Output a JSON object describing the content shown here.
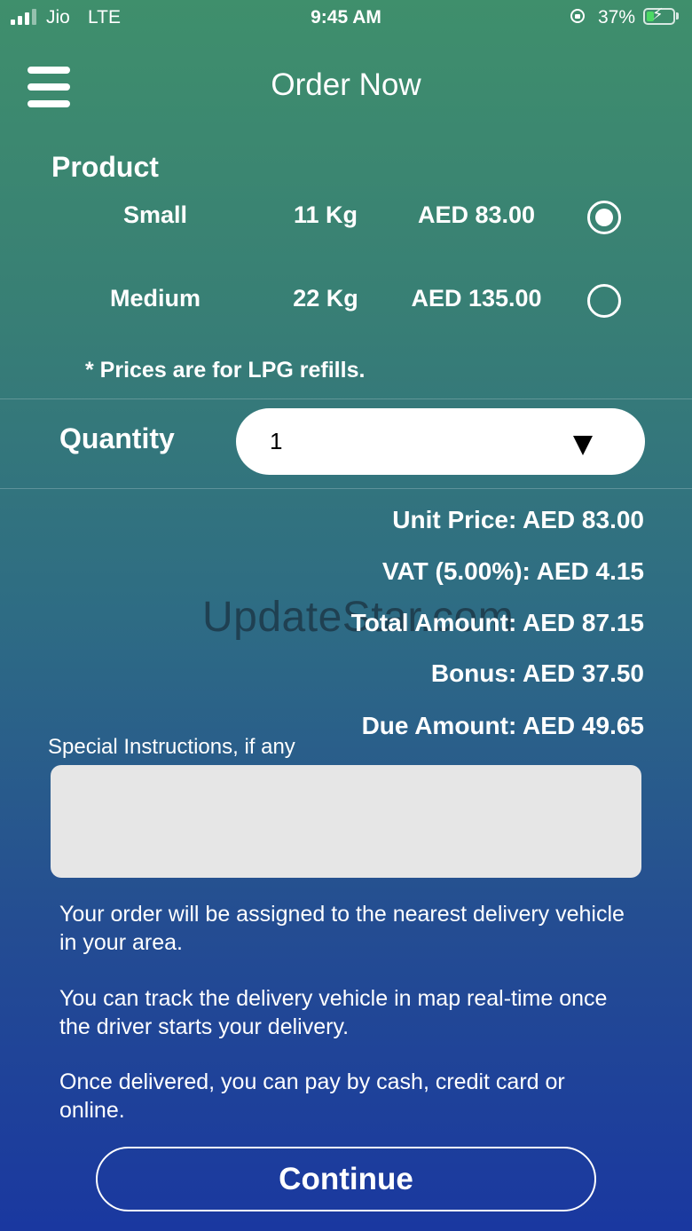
{
  "status_bar": {
    "carrier": "Jio",
    "network": "LTE",
    "time": "9:45 AM",
    "battery_percent": "37%",
    "battery_level": 0.37,
    "icons": [
      "signal-icon",
      "orientation-lock-icon",
      "battery-charging-icon"
    ]
  },
  "header": {
    "title": "Order Now",
    "menu_icon": "hamburger-menu-icon"
  },
  "product": {
    "label": "Product",
    "options": [
      {
        "name": "Small",
        "weight": "11 Kg",
        "price": "AED 83.00",
        "selected": true
      },
      {
        "name": "Medium",
        "weight": "22 Kg",
        "price": "AED 135.00",
        "selected": false
      }
    ],
    "note": "* Prices are for LPG refills."
  },
  "quantity": {
    "label": "Quantity",
    "value": "1",
    "icon": "dropdown-arrow-icon"
  },
  "summary": {
    "unit_price": "Unit Price: AED 83.00",
    "vat": "VAT (5.00%): AED 4.15",
    "total": "Total Amount: AED 87.15",
    "bonus": "Bonus: AED 37.50",
    "due": "Due Amount: AED 49.65"
  },
  "watermark": "UpdateStar.com",
  "instructions": {
    "label": "Special Instructions, if any",
    "value": ""
  },
  "info": [
    "Your order will be assigned to the nearest delivery vehicle in your area.",
    "You can track the delivery vehicle in map real-time once the driver starts your delivery.",
    "Once delivered, you can pay by cash, credit card or online."
  ],
  "continue_label": "Continue",
  "colors": {
    "gradient_top": "#3f8f6c",
    "gradient_bottom": "#1a38a0",
    "battery_fill": "#4cd964",
    "input_bg": "#e6e6e6"
  }
}
